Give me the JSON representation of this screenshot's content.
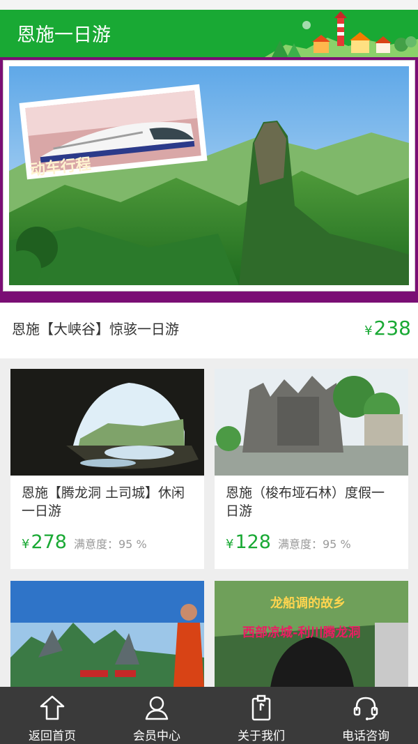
{
  "header": {
    "title": "恩施一日游"
  },
  "banner": {
    "caption": "动车行程"
  },
  "featured": {
    "name": "恩施【大峡谷】惊骇一日游",
    "currency": "¥",
    "price": "238"
  },
  "cards": [
    {
      "name": "恩施【腾龙洞 土司城】休闲一日游",
      "currency": "¥",
      "price": "278",
      "satisfaction": "满意度：95 %"
    },
    {
      "name": "恩施（梭布垭石林）度假一日游",
      "currency": "¥",
      "price": "128",
      "satisfaction": "满意度：95 %"
    },
    {
      "photo_text_1": "龙船调的故乡",
      "photo_text_2": "西部凉城-利川腾龙洞"
    }
  ],
  "tabs": [
    {
      "label": "返回首页",
      "icon": "home-icon"
    },
    {
      "label": "会员中心",
      "icon": "user-icon"
    },
    {
      "label": "关于我们",
      "icon": "clipboard-icon"
    },
    {
      "label": "电话咨询",
      "icon": "headset-icon"
    }
  ],
  "colors": {
    "brand": "#19a934",
    "banner_border": "#7a0e74",
    "tabbar": "#3a3a3a"
  }
}
